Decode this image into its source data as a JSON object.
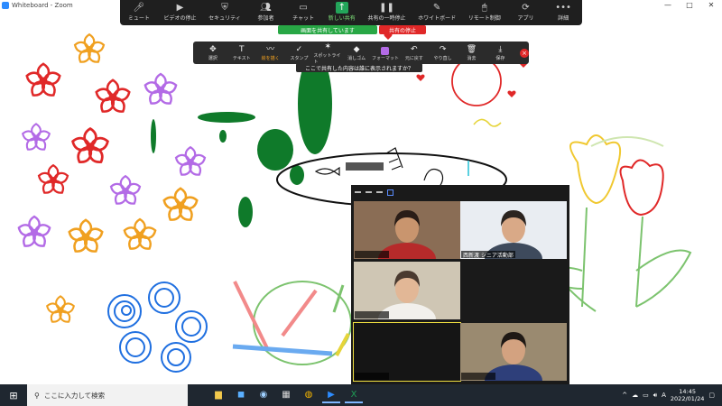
{
  "window": {
    "title": "Whiteboard - Zoom",
    "controls": [
      "—",
      "□",
      "✕"
    ]
  },
  "meeting_toolbar": [
    {
      "icon": "microphone-icon",
      "glyph": "🎤︎",
      "label": "ミュート"
    },
    {
      "icon": "video-icon",
      "glyph": "▶",
      "label": "ビデオの停止"
    },
    {
      "icon": "shield-icon",
      "glyph": "⛨",
      "label": "セキュリティ"
    },
    {
      "icon": "participants-icon",
      "glyph": "👥︎",
      "label": "参加者",
      "count": "7"
    },
    {
      "icon": "chat-icon",
      "glyph": "▭",
      "label": "チャット"
    },
    {
      "icon": "share-icon",
      "glyph": "↑",
      "label": "新しい共有",
      "green": true
    },
    {
      "icon": "pause-icon",
      "glyph": "❚❚",
      "label": "共有の一時停止"
    },
    {
      "icon": "whiteboard-pen-icon",
      "glyph": "✎",
      "label": "ホワイトボード"
    },
    {
      "icon": "remote-control-icon",
      "glyph": "🖱︎",
      "label": "リモート制御"
    },
    {
      "icon": "apps-icon",
      "glyph": "⟳",
      "label": "アプリ"
    },
    {
      "icon": "more-icon",
      "glyph": "•••",
      "label": "詳細"
    }
  ],
  "share_banner": "画面を共有しています",
  "stop_share": "共有の停止",
  "annotation_toolbar": [
    {
      "icon": "move-icon",
      "glyph": "✥",
      "label": "選択"
    },
    {
      "icon": "text-icon",
      "glyph": "T",
      "label": "テキスト"
    },
    {
      "icon": "draw-icon",
      "glyph": "〰",
      "label": "絵を描く",
      "active": true
    },
    {
      "icon": "stamp-icon",
      "glyph": "✓",
      "label": "スタンプ"
    },
    {
      "icon": "spotlight-icon",
      "glyph": "✶",
      "label": "スポットライト"
    },
    {
      "icon": "eraser-icon",
      "glyph": "◆",
      "label": "消しゴム"
    },
    {
      "icon": "format-color-icon",
      "glyph": "",
      "label": "フォーマット",
      "purple": true
    },
    {
      "icon": "undo-icon",
      "glyph": "↶",
      "label": "元に戻す"
    },
    {
      "icon": "redo-icon",
      "glyph": "↷",
      "label": "やり直し"
    },
    {
      "icon": "trash-icon",
      "glyph": "🗑︎",
      "label": "消去"
    },
    {
      "icon": "save-icon",
      "glyph": "⤓",
      "label": "保存"
    }
  ],
  "annotation_message": "ここで共有した内容は誰に表示されますか？",
  "gallery": {
    "tiles": [
      {
        "name": "",
        "bg": "#8a6d55",
        "skin": "#c9956e",
        "hair": "#2a1d17",
        "shirt": "#b62a2a"
      },
      {
        "name": "西新渡 シニア活動部",
        "bg": "#e9edf2",
        "skin": "#d9a987",
        "hair": "#2b2420",
        "shirt": "#3e4a5c"
      },
      {
        "name": "",
        "bg": "#cfc6b4",
        "skin": "#e2b796",
        "hair": "#4a3a30",
        "shirt": "#f2f0ec"
      },
      {
        "name": "",
        "bg": "#151515",
        "skin": "",
        "hair": "",
        "shirt": ""
      },
      {
        "name": "",
        "bg": "#9a8a70",
        "skin": "#d3a280",
        "hair": "#1f1915",
        "shirt": "#2e3f7a"
      }
    ]
  },
  "taskbar": {
    "search_placeholder": "ここに入力して検索",
    "apps": [
      {
        "icon": "file-explorer-icon",
        "glyph": "▆",
        "color": "#f2c94c"
      },
      {
        "icon": "notes-app-icon",
        "glyph": "◼",
        "color": "#5ab0ff"
      },
      {
        "icon": "web-app-icon",
        "glyph": "◉",
        "color": "#9fd0ff"
      },
      {
        "icon": "calculator-icon",
        "glyph": "▦",
        "color": "#d7d7d7"
      },
      {
        "icon": "chrome-icon",
        "glyph": "◍",
        "color": "#f4b400"
      },
      {
        "icon": "zoom-app-icon",
        "glyph": "▶",
        "color": "#2d8cff",
        "open": true
      },
      {
        "icon": "excel-icon",
        "glyph": "X",
        "color": "#1f9d55",
        "open": true
      }
    ],
    "tray": [
      "^",
      "☁",
      "▭",
      "🔊︎",
      "A"
    ],
    "time": "14:45",
    "date": "2022/01/24"
  }
}
